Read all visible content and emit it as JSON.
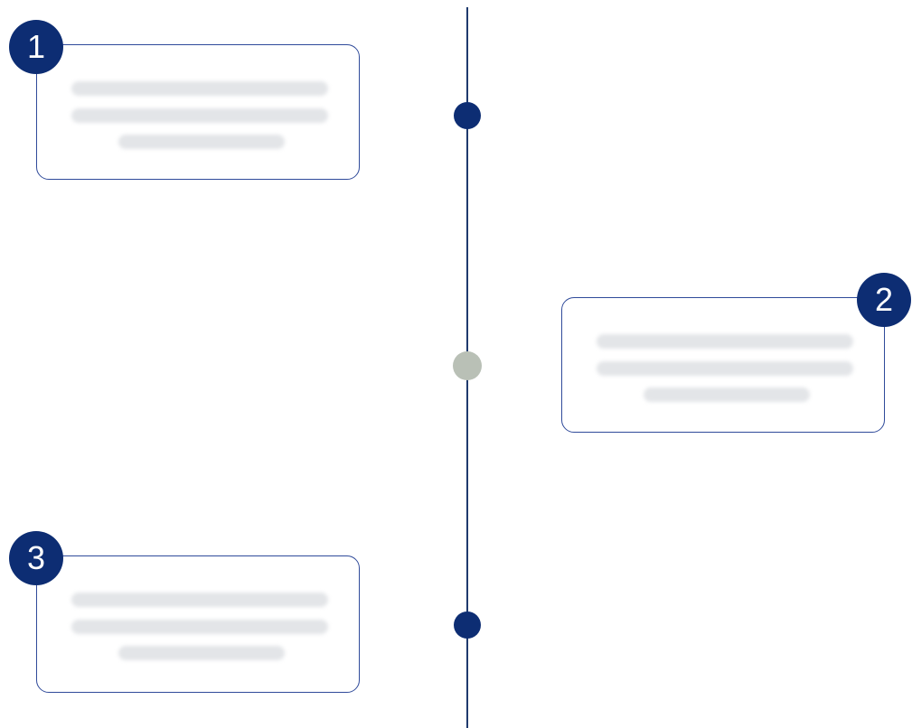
{
  "colors": {
    "timeline": "#1f3a6d",
    "node_active": "#0d2d73",
    "node_inactive": "#b9c0b6",
    "card_border": "#2f4a9a",
    "badge_fill": "#0d2d73",
    "placeholder_text": "#e3e5e8"
  },
  "timeline": {
    "steps": [
      {
        "badge": "1",
        "side": "left",
        "node_state": "active"
      },
      {
        "badge": "2",
        "side": "right",
        "node_state": "inactive"
      },
      {
        "badge": "3",
        "side": "left",
        "node_state": "active"
      }
    ]
  },
  "icons": {
    "node": "circle-marker-icon"
  }
}
